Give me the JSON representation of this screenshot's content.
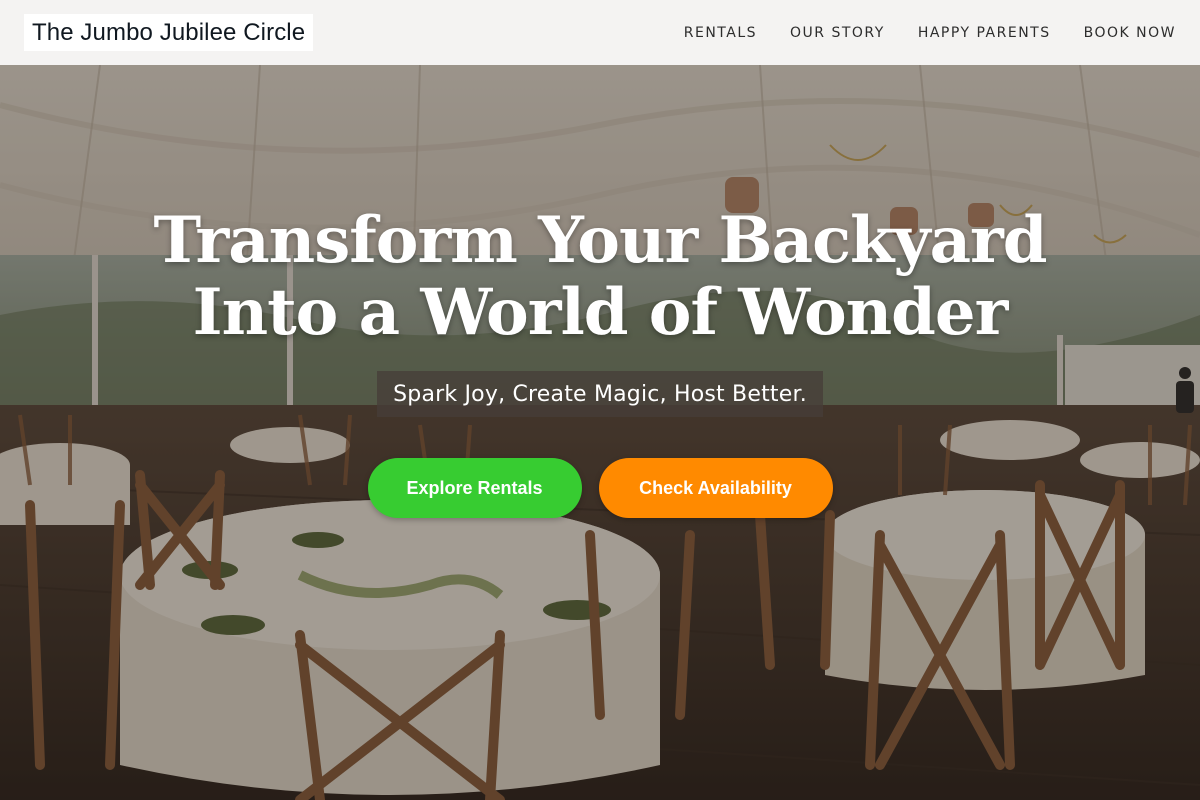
{
  "header": {
    "logo": "The Jumbo Jubilee Circle",
    "nav": [
      {
        "label": "RENTALS"
      },
      {
        "label": "OUR STORY"
      },
      {
        "label": "HAPPY PARENTS"
      },
      {
        "label": "BOOK NOW"
      }
    ]
  },
  "hero": {
    "headline": "Transform Your Backyard Into a World of Wonder",
    "tagline": "Spark Joy, Create Magic, Host Better.",
    "primary_cta": "Explore Rentals",
    "secondary_cta": "Check Availability",
    "background": "banquet-tent-photo"
  },
  "colors": {
    "header_bg": "#f4f3f2",
    "primary_button": "#37cc31",
    "secondary_button": "#ff8a00",
    "text_on_hero": "#ffffff"
  }
}
